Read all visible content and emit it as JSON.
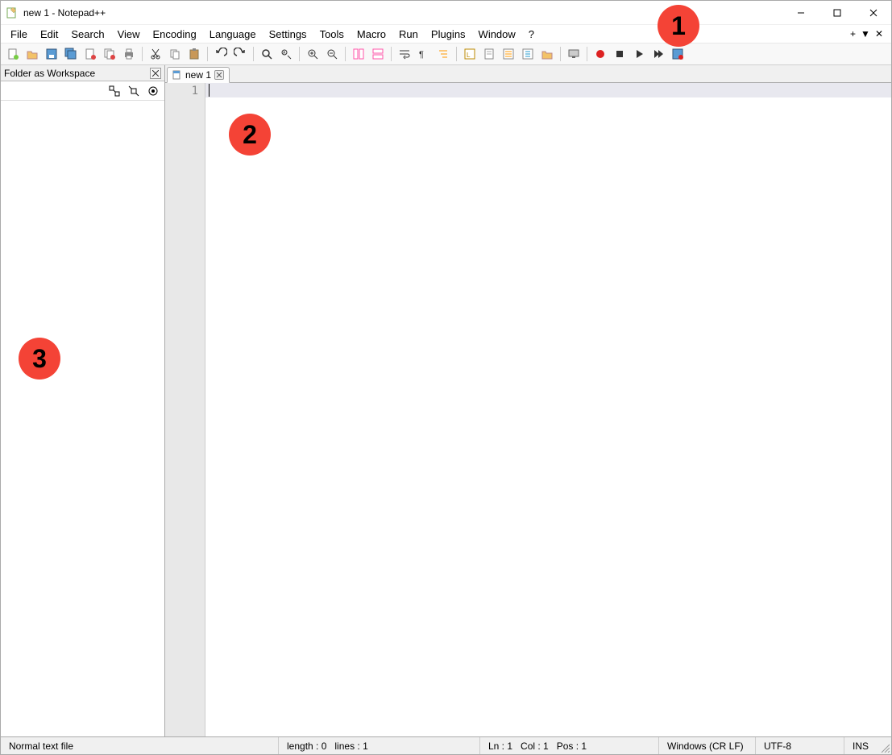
{
  "window": {
    "title": "new 1 - Notepad++"
  },
  "menu": {
    "items": [
      "File",
      "Edit",
      "Search",
      "View",
      "Encoding",
      "Language",
      "Settings",
      "Tools",
      "Macro",
      "Run",
      "Plugins",
      "Window",
      "?"
    ],
    "right_plus": "+",
    "right_down": "▼",
    "right_close": "✕"
  },
  "toolbar": {
    "buttons": [
      {
        "name": "new-file-icon",
        "group": 0
      },
      {
        "name": "open-file-icon",
        "group": 0
      },
      {
        "name": "save-icon",
        "group": 0
      },
      {
        "name": "save-all-icon",
        "group": 0
      },
      {
        "name": "close-icon",
        "group": 0
      },
      {
        "name": "close-all-icon",
        "group": 0
      },
      {
        "name": "print-icon",
        "group": 0
      },
      {
        "name": "cut-icon",
        "group": 1
      },
      {
        "name": "copy-icon",
        "group": 1
      },
      {
        "name": "paste-icon",
        "group": 1
      },
      {
        "name": "undo-icon",
        "group": 2
      },
      {
        "name": "redo-icon",
        "group": 2
      },
      {
        "name": "find-icon",
        "group": 3
      },
      {
        "name": "replace-icon",
        "group": 3
      },
      {
        "name": "zoom-in-icon",
        "group": 4
      },
      {
        "name": "zoom-out-icon",
        "group": 4
      },
      {
        "name": "sync-v-icon",
        "group": 5
      },
      {
        "name": "sync-h-icon",
        "group": 5
      },
      {
        "name": "wordwrap-icon",
        "group": 6
      },
      {
        "name": "all-chars-icon",
        "group": 6
      },
      {
        "name": "indent-guide-icon",
        "group": 6
      },
      {
        "name": "lang-udl-icon",
        "group": 7
      },
      {
        "name": "doc-map-icon",
        "group": 7
      },
      {
        "name": "doc-list-icon",
        "group": 7
      },
      {
        "name": "func-list-icon",
        "group": 7
      },
      {
        "name": "folder-ws-icon",
        "group": 7
      },
      {
        "name": "monitor-icon",
        "group": 8
      },
      {
        "name": "record-macro-icon",
        "group": 9
      },
      {
        "name": "stop-macro-icon",
        "group": 9
      },
      {
        "name": "play-macro-icon",
        "group": 9
      },
      {
        "name": "play-multi-icon",
        "group": 9
      },
      {
        "name": "save-macro-icon",
        "group": 9
      }
    ]
  },
  "sidebar": {
    "title": "Folder as Workspace"
  },
  "tabs": [
    {
      "label": "new 1"
    }
  ],
  "editor": {
    "line_number": "1"
  },
  "status": {
    "file_type": "Normal text file",
    "length_label": "length : 0",
    "lines_label": "lines : 1",
    "ln_label": "Ln : 1",
    "col_label": "Col : 1",
    "pos_label": "Pos : 1",
    "eol": "Windows (CR LF)",
    "encoding": "UTF-8",
    "ins": "INS"
  },
  "annotations": {
    "1": "1",
    "2": "2",
    "3": "3"
  }
}
